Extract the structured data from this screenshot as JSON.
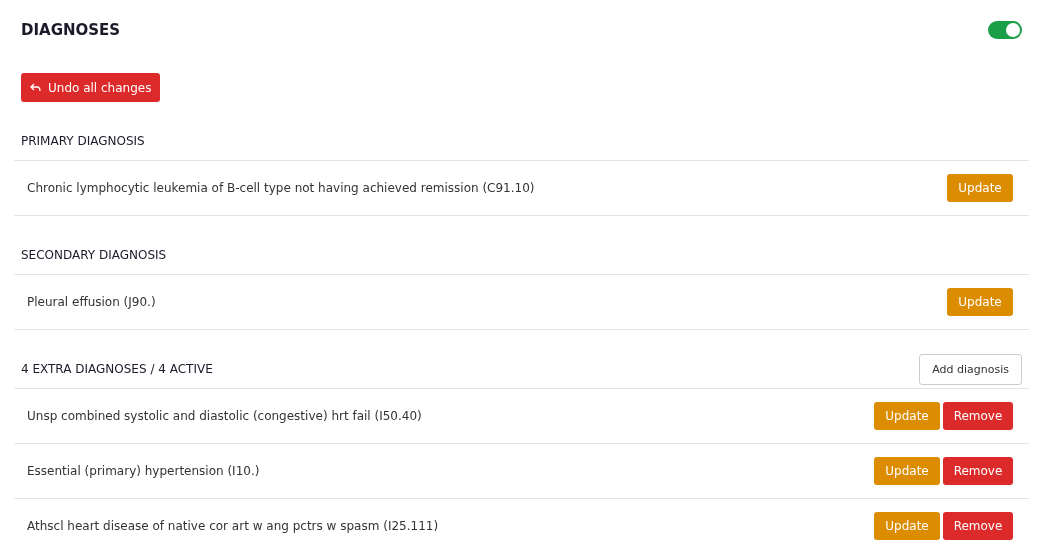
{
  "header": {
    "title": "DIAGNOSES",
    "toggle": {
      "on": true
    }
  },
  "undo_button": {
    "label": "Undo all changes"
  },
  "sections": [
    {
      "title": "PRIMARY DIAGNOSIS",
      "items": [
        {
          "text": "Chronic lymphocytic leukemia of B-cell type not having achieved remission (C91.10)",
          "buttons": [
            {
              "label": "Update",
              "kind": "update"
            }
          ]
        }
      ]
    },
    {
      "title": "SECONDARY DIAGNOSIS",
      "items": [
        {
          "text": "Pleural effusion (J90.)",
          "buttons": [
            {
              "label": "Update",
              "kind": "update"
            }
          ]
        }
      ]
    },
    {
      "title": "4 EXTRA DIAGNOSES / 4 ACTIVE",
      "action": "Add diagnosis",
      "items": [
        {
          "text": "Unsp combined systolic and diastolic (congestive) hrt fail (I50.40)",
          "buttons": [
            {
              "label": "Update",
              "kind": "update"
            },
            {
              "label": "Remove",
              "kind": "remove"
            }
          ]
        },
        {
          "text": "Essential (primary) hypertension (I10.)",
          "buttons": [
            {
              "label": "Update",
              "kind": "update"
            },
            {
              "label": "Remove",
              "kind": "remove"
            }
          ]
        },
        {
          "text": "Athscl heart disease of native cor art w ang pctrs w spasm (I25.111)",
          "buttons": [
            {
              "label": "Update",
              "kind": "update"
            },
            {
              "label": "Remove",
              "kind": "remove"
            }
          ]
        }
      ]
    }
  ]
}
